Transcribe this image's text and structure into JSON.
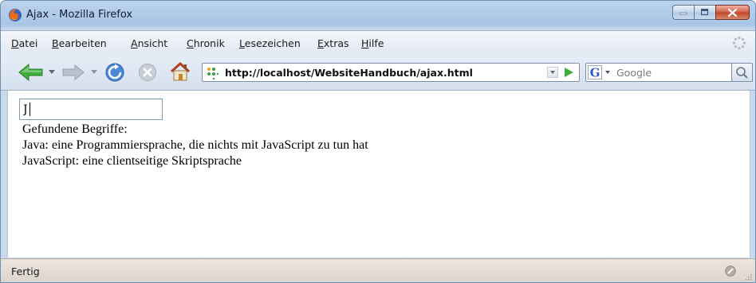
{
  "window": {
    "title": "Ajax - Mozilla Firefox"
  },
  "menu": {
    "items": [
      {
        "underline": "D",
        "rest": "atei"
      },
      {
        "underline": "B",
        "rest": "earbeiten"
      },
      {
        "underline": "A",
        "rest": "nsicht"
      },
      {
        "underline": "C",
        "rest": "hronik"
      },
      {
        "underline": "L",
        "rest": "esezeichen"
      },
      {
        "underline": "E",
        "rest": "xtras"
      },
      {
        "underline": "H",
        "rest": "ilfe"
      }
    ]
  },
  "toolbar": {
    "url": "http://localhost/WebsiteHandbuch/ajax.html",
    "search_placeholder": "Google",
    "search_engine_letter": "G"
  },
  "page": {
    "input_value": "J",
    "results_heading": "Gefundene Begriffe:",
    "results": [
      "Java: eine Programmiersprache, die nichts mit JavaScript zu tun hat",
      "JavaScript: eine clientseitige Skriptsprache"
    ]
  },
  "status": {
    "text": "Fertig"
  },
  "colors": {
    "back_arrow": "#3fae3f",
    "close_button": "#c24429",
    "google_blue": "#2a56c6"
  }
}
